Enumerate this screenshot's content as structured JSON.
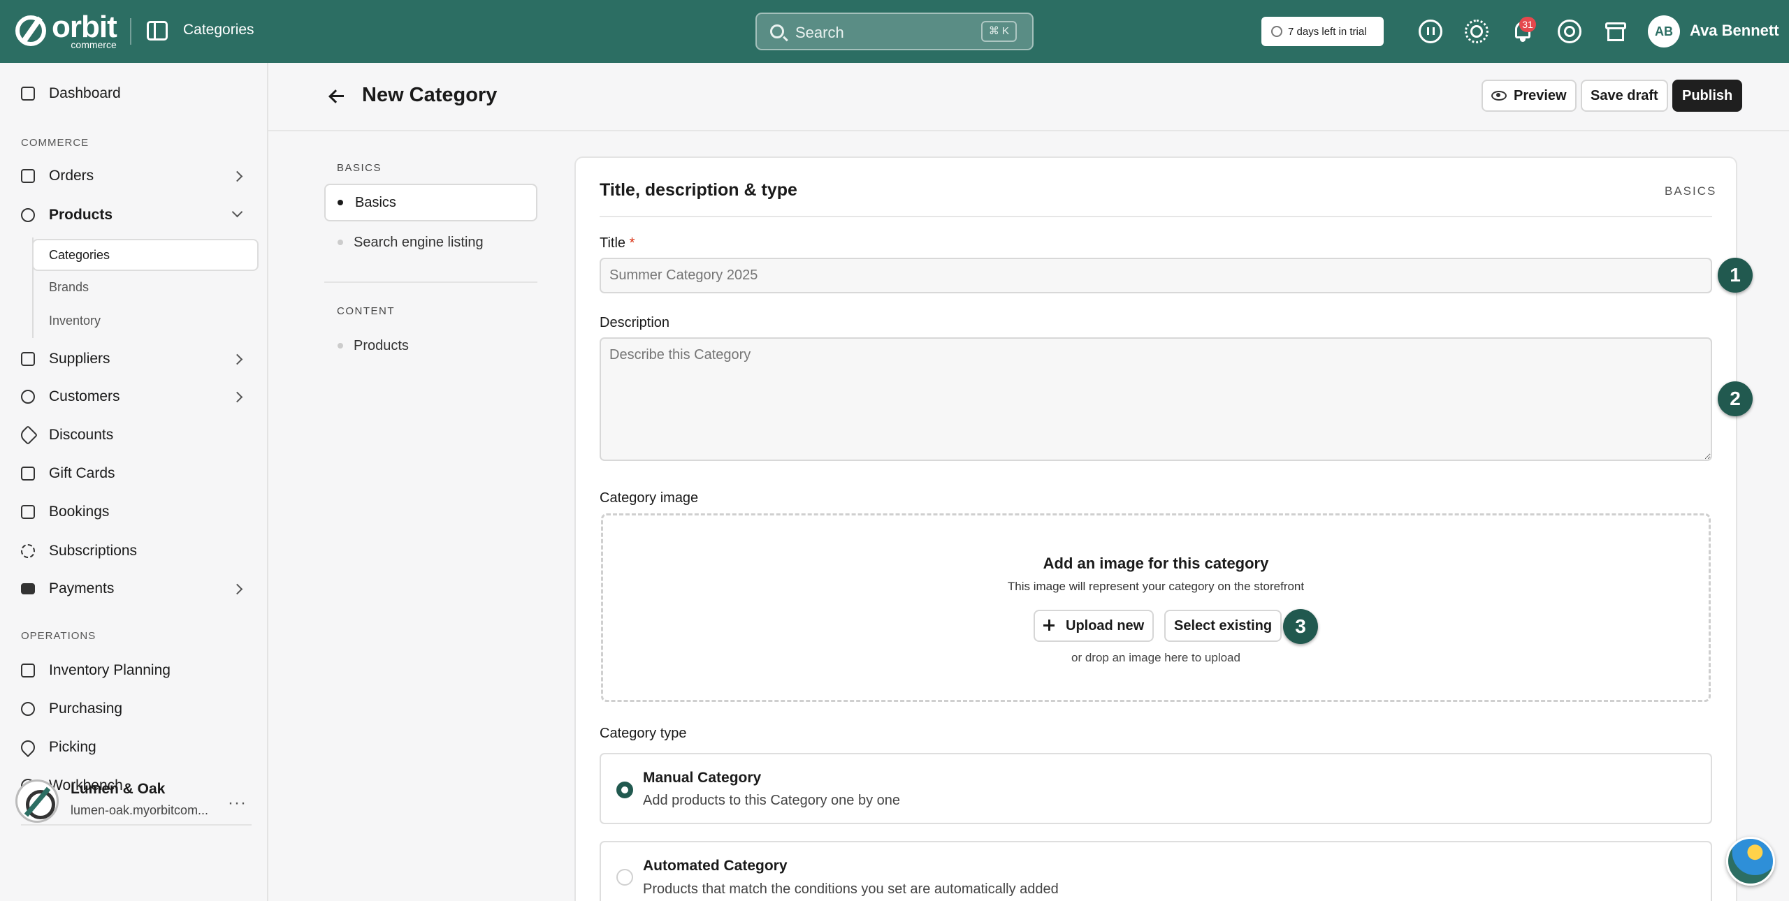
{
  "topbar": {
    "logo_text": "orbit",
    "logo_sub": "commerce",
    "breadcrumb": "Categories",
    "search_placeholder": "Search",
    "search_shortcut": "⌘ K",
    "trial_text": "7 days left in trial",
    "notification_count": "31",
    "user_initials": "AB",
    "user_name": "Ava Bennett",
    "brand_color": "#2c6e63"
  },
  "sidebar": {
    "dashboard": "Dashboard",
    "commerce_label": "COMMERCE",
    "orders": "Orders",
    "products": "Products",
    "product_sub": [
      "Categories",
      "Brands",
      "Inventory"
    ],
    "suppliers": "Suppliers",
    "customers": "Customers",
    "discounts": "Discounts",
    "gift_cards": "Gift Cards",
    "bookings": "Bookings",
    "subscriptions": "Subscriptions",
    "payments": "Payments",
    "operations_label": "OPERATIONS",
    "inventory_planning": "Inventory Planning",
    "purchasing": "Purchasing",
    "picking": "Picking",
    "workbench": "Workbench",
    "store_name": "Lumen & Oak",
    "store_url": "lumen-oak.myorbitcom...",
    "store_more": "···"
  },
  "header": {
    "title": "New Category",
    "preview": "Preview",
    "save_draft": "Save draft",
    "publish": "Publish"
  },
  "page_nav": {
    "basics_label": "BASICS",
    "basics": "Basics",
    "seo": "Search engine listing",
    "content_label": "CONTENT",
    "products": "Products"
  },
  "form": {
    "section_title": "Title, description & type",
    "section_tag": "BASICS",
    "title_label": "Title",
    "required_mark": "*",
    "title_placeholder": "Summer Category 2025",
    "description_label": "Description",
    "description_placeholder": "Describe this Category",
    "image_label": "Category image",
    "image_title": "Add an image for this category",
    "image_sub": "This image will represent your category on the storefront",
    "upload_new": "Upload new",
    "select_existing": "Select existing",
    "drop_hint": "or drop an image here to upload",
    "type_label": "Category type",
    "manual_title": "Manual Category",
    "manual_sub": "Add products to this Category one by one",
    "auto_title": "Automated Category",
    "auto_sub": "Products that match the conditions you set are automatically added",
    "selected_type": "Manual Category",
    "steps": [
      "1",
      "2",
      "3"
    ]
  }
}
